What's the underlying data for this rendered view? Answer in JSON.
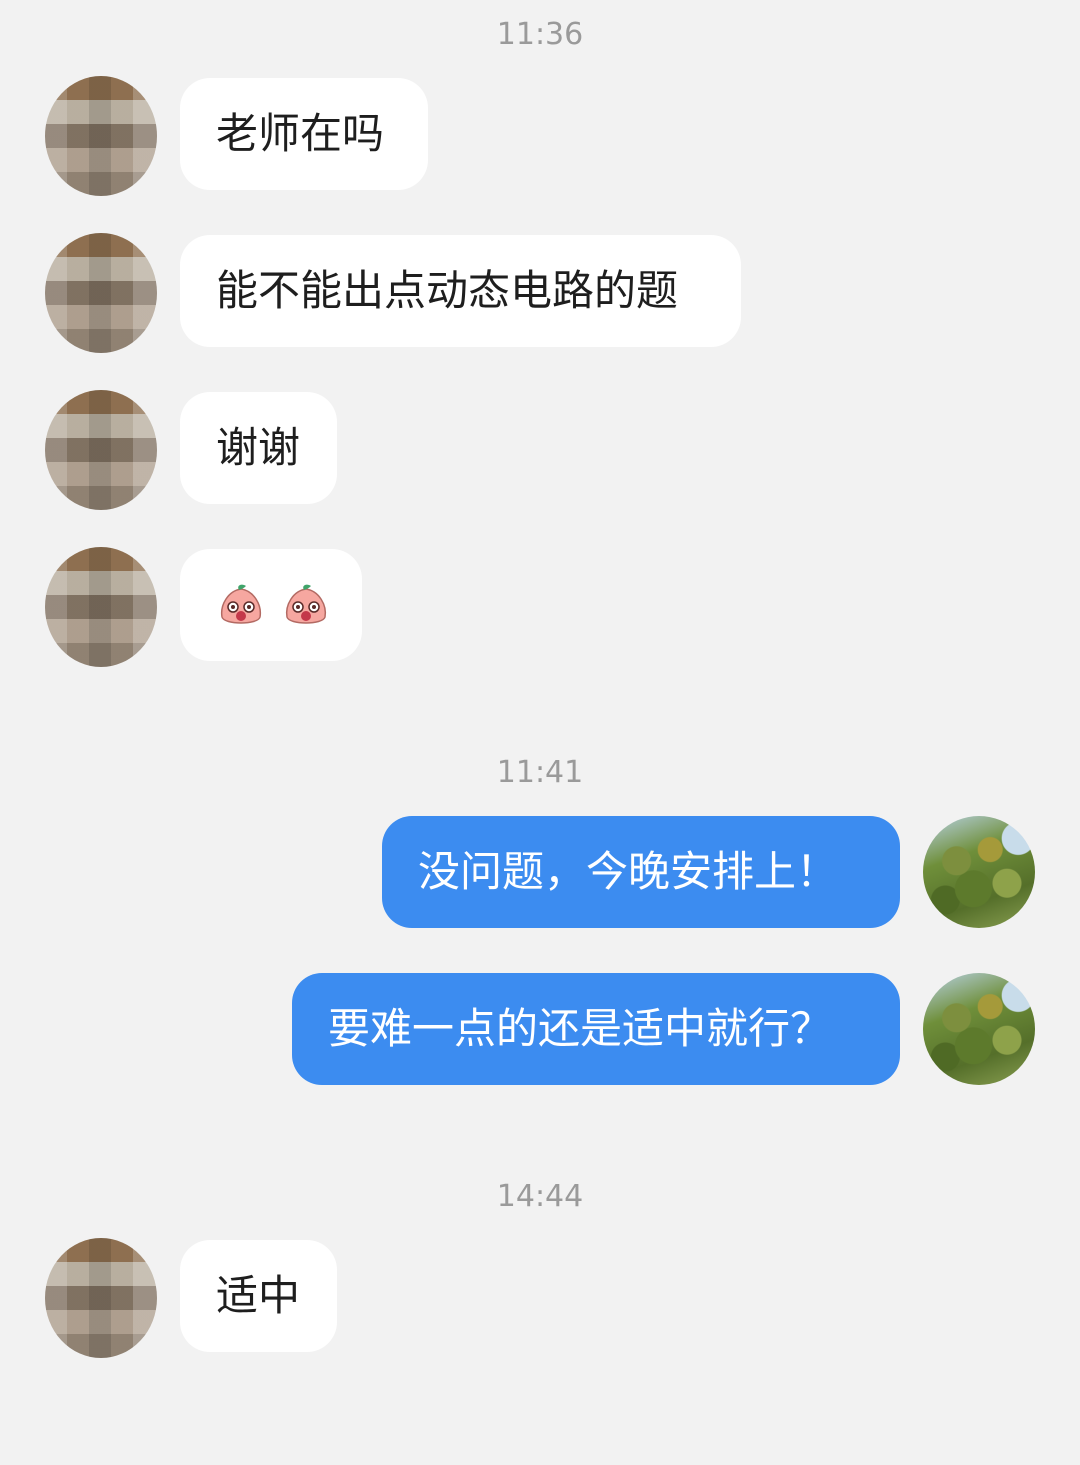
{
  "timestamps": [
    "11:36",
    "11:41",
    "14:44"
  ],
  "messages": [
    {
      "side": "left",
      "text": "老师在吗"
    },
    {
      "side": "left",
      "text": "能不能出点动态电路的题"
    },
    {
      "side": "left",
      "text": "谢谢"
    },
    {
      "side": "left",
      "stickers": [
        "peach-face-sticker",
        "peach-face-sticker"
      ]
    },
    {
      "side": "right",
      "text": "没问题，今晚安排上！"
    },
    {
      "side": "right",
      "text": "要难一点的还是适中就行？"
    },
    {
      "side": "left",
      "text": "适中"
    }
  ],
  "colors": {
    "background": "#f2f2f2",
    "incoming_bubble": "#ffffff",
    "outgoing_bubble": "#3c8cf0",
    "timestamp": "#9a9a9a"
  }
}
